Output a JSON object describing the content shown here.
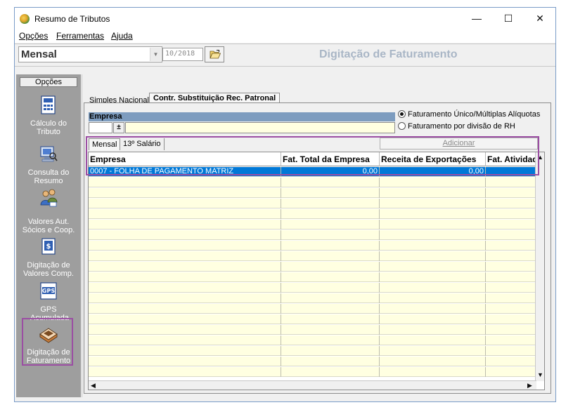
{
  "window": {
    "title": "Resumo de Tributos",
    "minimize": "—",
    "maximize": "☐",
    "close": "✕"
  },
  "menu": {
    "items": [
      "Opções",
      "Ferramentas",
      "Ajuda"
    ]
  },
  "toolbar": {
    "period_select_value": "Mensal",
    "date_value": "10/2018",
    "folder_icon": "folder-open-icon",
    "page_heading": "Digitação de Faturamento"
  },
  "sidebar": {
    "header": "Opções",
    "items": [
      {
        "icon": "calculator-document-icon",
        "label": "Cálculo do Tributo"
      },
      {
        "icon": "computer-search-icon",
        "label": "Consulta do Resumo"
      },
      {
        "icon": "people-money-icon",
        "label": "Valores Aut. Sócios e  Coop."
      },
      {
        "icon": "document-money-icon",
        "label": "Digitação de Valores Comp."
      },
      {
        "icon": "gps-document-icon",
        "label": "GPS Acumulada",
        "icon_text": "GPS"
      },
      {
        "icon": "keyboard-book-icon",
        "label": "Digitação de Faturamento"
      }
    ],
    "accent_color": "#9b4ea3"
  },
  "tabs": {
    "outer": [
      "Simples Nacional",
      "Contr. Substituição Rec. Patronal"
    ],
    "inner": [
      "Mensal",
      "13º Salário"
    ]
  },
  "form": {
    "empresa_label": "Empresa",
    "radio_options": [
      "Faturamento Único/Múltiplas Alíquotas",
      "Faturamento por divisão de RH"
    ],
    "selected_radio": 0,
    "add_button": "Adicionar"
  },
  "grid": {
    "columns": [
      "Empresa",
      "Fat. Total da Empresa",
      "Receita de Exportações",
      "Fat. Atividades"
    ],
    "rows": [
      [
        "0007 - FOLHA DE PAGAMENTO MATRIZ",
        "0,00",
        "0,00",
        ""
      ]
    ],
    "selected_row_color": "#0078d7",
    "empty_row_color": "#ffffe1"
  }
}
